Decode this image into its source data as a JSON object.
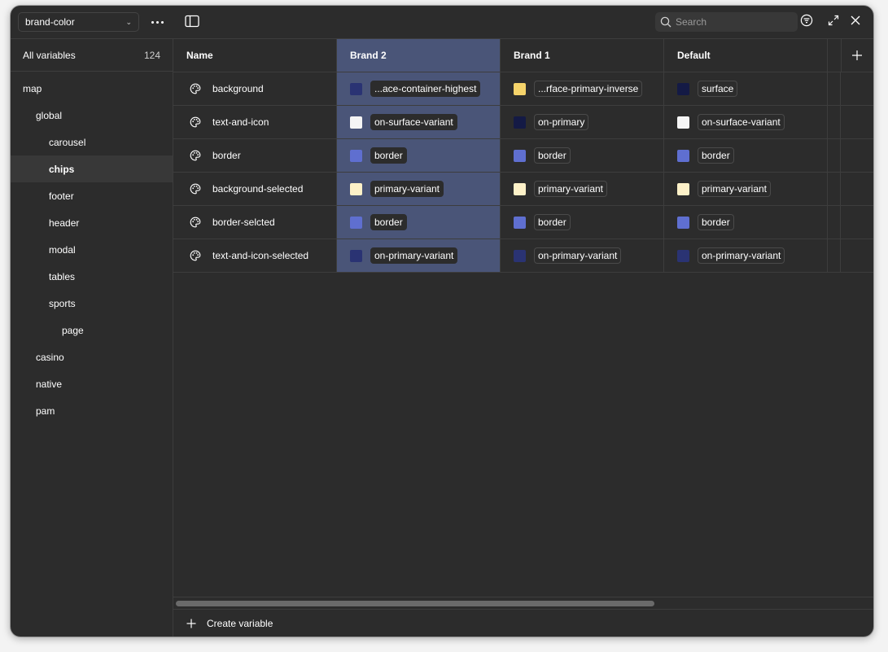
{
  "collection": {
    "selected": "brand-color"
  },
  "search": {
    "placeholder": "Search"
  },
  "sidebar": {
    "all_variables_label": "All variables",
    "all_variables_count": "124",
    "groups": [
      {
        "label": "map",
        "level": 0
      },
      {
        "label": "global",
        "level": 1
      },
      {
        "label": "carousel",
        "level": 2
      },
      {
        "label": "chips",
        "level": 2,
        "selected": true
      },
      {
        "label": "footer",
        "level": 2
      },
      {
        "label": "header",
        "level": 2
      },
      {
        "label": "modal",
        "level": 2
      },
      {
        "label": "tables",
        "level": 2
      },
      {
        "label": "sports",
        "level": 2
      },
      {
        "label": "page",
        "level": 3
      },
      {
        "label": "casino",
        "level": 1
      },
      {
        "label": "native",
        "level": 1
      },
      {
        "label": "pam",
        "level": 1
      }
    ]
  },
  "table": {
    "columns": [
      "Name",
      "Brand 2",
      "Brand 1",
      "Default"
    ],
    "rows": [
      {
        "name": "background",
        "values": [
          {
            "label": "...ace-container-highest",
            "color": "#2a3373"
          },
          {
            "label": "...rface-primary-inverse",
            "color": "#f5d36a"
          },
          {
            "label": "surface",
            "color": "#141a45"
          }
        ]
      },
      {
        "name": "text-and-icon",
        "values": [
          {
            "label": "on-surface-variant",
            "color": "#f5f5f5"
          },
          {
            "label": "on-primary",
            "color": "#141a45"
          },
          {
            "label": "on-surface-variant",
            "color": "#f5f5f5"
          }
        ]
      },
      {
        "name": "border",
        "values": [
          {
            "label": "border",
            "color": "#5f6fd0"
          },
          {
            "label": "border",
            "color": "#5f6fd0"
          },
          {
            "label": "border",
            "color": "#5f6fd0"
          }
        ]
      },
      {
        "name": "background-selected",
        "values": [
          {
            "label": "primary-variant",
            "color": "#fdf1c8"
          },
          {
            "label": "primary-variant",
            "color": "#fdf1c8"
          },
          {
            "label": "primary-variant",
            "color": "#fdf1c8"
          }
        ]
      },
      {
        "name": "border-selcted",
        "values": [
          {
            "label": "border",
            "color": "#5f6fd0"
          },
          {
            "label": "border",
            "color": "#5f6fd0"
          },
          {
            "label": "border",
            "color": "#5f6fd0"
          }
        ]
      },
      {
        "name": "text-and-icon-selected",
        "values": [
          {
            "label": "on-primary-variant",
            "color": "#2a3373"
          },
          {
            "label": "on-primary-variant",
            "color": "#2a3373"
          },
          {
            "label": "on-primary-variant",
            "color": "#2a3373"
          }
        ]
      }
    ]
  },
  "footer": {
    "create_label": "Create variable"
  }
}
